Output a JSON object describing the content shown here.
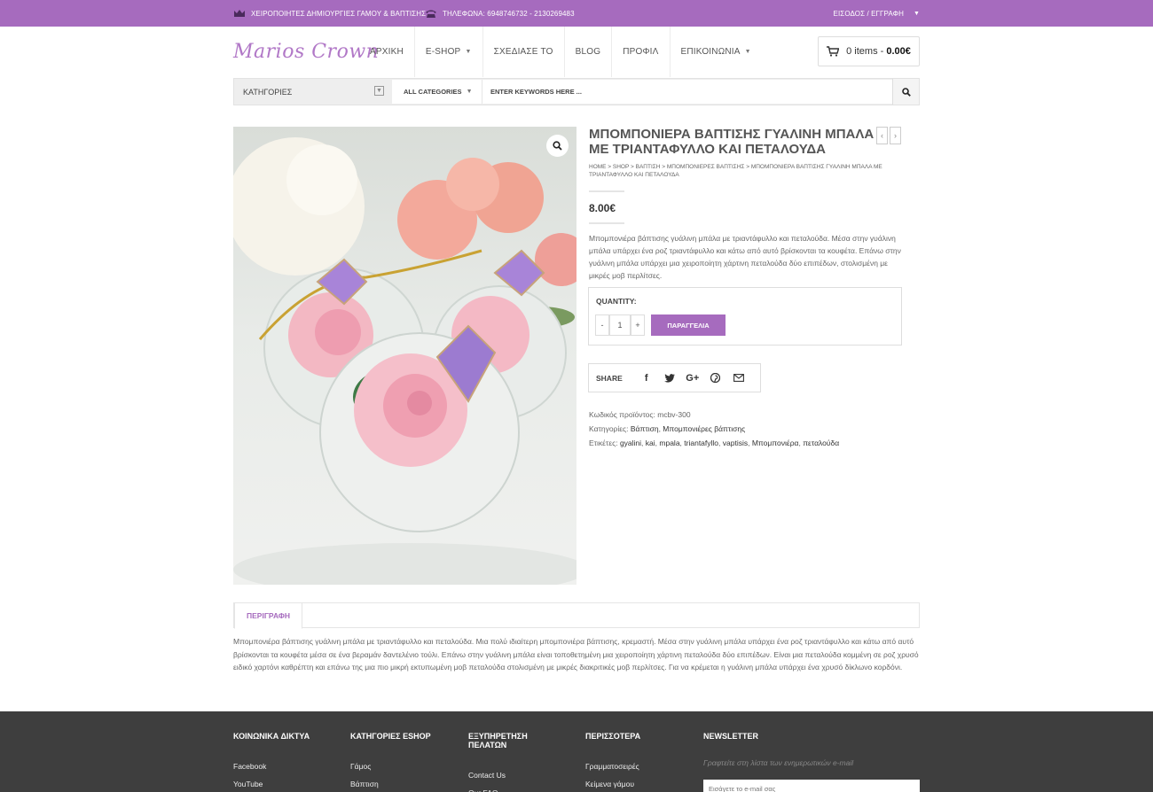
{
  "topbar": {
    "tagline": "ΧΕΙΡΟΠΟΙΗΤΕΣ ΔΗΜΙΟΥΡΓΙΕΣ ΓΑΜΟΥ & ΒΑΠΤΙΣΗΣ",
    "phone": "ΤΗΛΕΦΩΝΑ: 6948746732 - 2130269483",
    "login": "ΕΙΣΟΔΟΣ / ΕΓΓΡΑΦΗ",
    "bg_color": "#a66bbe"
  },
  "header": {
    "logo": "Marios Crown",
    "nav": [
      {
        "label": "ΑΡΧΙΚΗ"
      },
      {
        "label": "E-SHOP"
      },
      {
        "label": "ΣΧΕΔΙΑΣΕ ΤΟ"
      },
      {
        "label": "BLOG"
      },
      {
        "label": "ΠΡΟΦΙΛ"
      },
      {
        "label": "ΕΠΙΚΟΙΝΩΝΙΑ"
      }
    ],
    "cart": {
      "items": "0 items",
      "sep": " - ",
      "total": "0.00€"
    }
  },
  "search": {
    "categories_label": "ΚΑΤΗΓΟΡΙΕΣ",
    "all_categories": "ALL CATEGORIES",
    "placeholder": "ENTER KEYWORDS HERE ..."
  },
  "product": {
    "title": "ΜΠΟΜΠΟΝΙΕΡΑ ΒΑΠΤΙΣΗΣ ΓΥΑΛΙΝΗ ΜΠΑΛΑ ΜΕ ΤΡΙΑΝΤΑΦΥΛΛΟ ΚΑΙ ΠΕΤΑΛΟΥΔΑ",
    "breadcrumb": "HOME > SHOP > ΒΑΠΤΙΣΗ > ΜΠΟΜΠΟΝΙΕΡΕΣ ΒΑΠΤΙΣΗΣ > ΜΠΟΜΠΟΝΙΕΡΑ ΒΑΠΤΙΣΗΣ ΓΥΑΛΙΝΗ ΜΠΑΛΑ ΜΕ ΤΡΙΑΝΤΑΦΥΛΛΟ ΚΑΙ ΠΕΤΑΛΟΥΔΑ",
    "price": "8.00€",
    "short_description": "Μπομπονιέρα βάπτισης γυάλινη μπάλα με τριαντάφυλλο και πεταλούδα. Μέσα στην γυάλινη μπάλα υπάρχει ένα ροζ τριαντάφυλλο και κάτω από αυτό βρίσκονται τα κουφέτα. Επάνω στην γυάλινη μπάλα υπάρχει μια χειροποίητη χάρτινη πεταλούδα δύο επιπέδων, στολισμένη με μικρές μοβ περλίτσες.",
    "quantity_label": "QUANTITY:",
    "minus": "-",
    "quantity": "1",
    "plus": "+",
    "order_button": "ΠΑΡΑΓΓΕΛΙΑ",
    "share_label": "SHARE",
    "sku_label": "Κωδικός προϊόντος:",
    "sku": "mcbv-300",
    "categories_label": "Κατηγορίες:",
    "categories": [
      "Βάπτιση",
      "Μπομπονιέρες βάπτισης"
    ],
    "tags_label": "Ετικέτες:",
    "tags": [
      "gyalini",
      "kai",
      "mpala",
      "triantafyllo",
      "vaptisis",
      "Μπομπονιέρα",
      "πεταλούδα"
    ]
  },
  "tabs": {
    "description_tab": "ΠΕΡΙΓΡΑΦΗ",
    "description": "Μπομπονιέρα βάπτισης γυάλινη μπάλα με τριαντάφυλλο και πεταλούδα. Μια πολύ ιδιαίτερη μπομπονιέρα βάπτισης, κρεμαστή. Μέσα στην γυάλινη μπάλα υπάρχει ένα ροζ τριαντάφυλλο και κάτω από αυτό βρίσκονται τα κουφέτα μέσα σε ένα βεραμάν δαντελένιο τούλι. Επάνω στην γυάλινη μπάλα είναι τοποθετημένη μια χειροποίητη χάρτινη πεταλούδα δύο επιπέδων. Είναι μια πεταλούδα κομμένη σε ροζ χρυσό ειδικό χαρτόνι καθρέπτη και επάνω της μια πιο μικρή εκτυπωμένη μοβ πεταλούδα στολισμένη με μικρές διακριτικές μοβ περλίτσες. Για να κρέμεται η γυάλινη μπάλα υπάρχει ένα χρυσό δίκλωνο κορδόνι."
  },
  "footer": {
    "social": {
      "title": "ΚΟΙΝΩΝΙΚΑ ΔΙΚΤΥΑ",
      "links": [
        "Facebook",
        "YouTube"
      ]
    },
    "eshop": {
      "title": "ΚΑΤΗΓΟΡΙΕΣ ESHOP",
      "links": [
        "Γάμος",
        "Βάπτιση"
      ]
    },
    "service": {
      "title": "ΕΞΥΠΗΡΕΤΗΣΗ ΠΕΛΑΤΩΝ",
      "links": [
        "Contact Us",
        "Our FAQ"
      ]
    },
    "more": {
      "title": "ΠΕΡΙΣΣΟΤΕΡΑ",
      "links": [
        "Γραμματοσειρές",
        "Κείμενα γάμου"
      ]
    },
    "newsletter": {
      "title": "NEWSLETTER",
      "text": "Γραφτείτε στη λίστα των ενημερωτικών e-mail",
      "placeholder": "Εισάγετε το e-mail σας"
    }
  }
}
